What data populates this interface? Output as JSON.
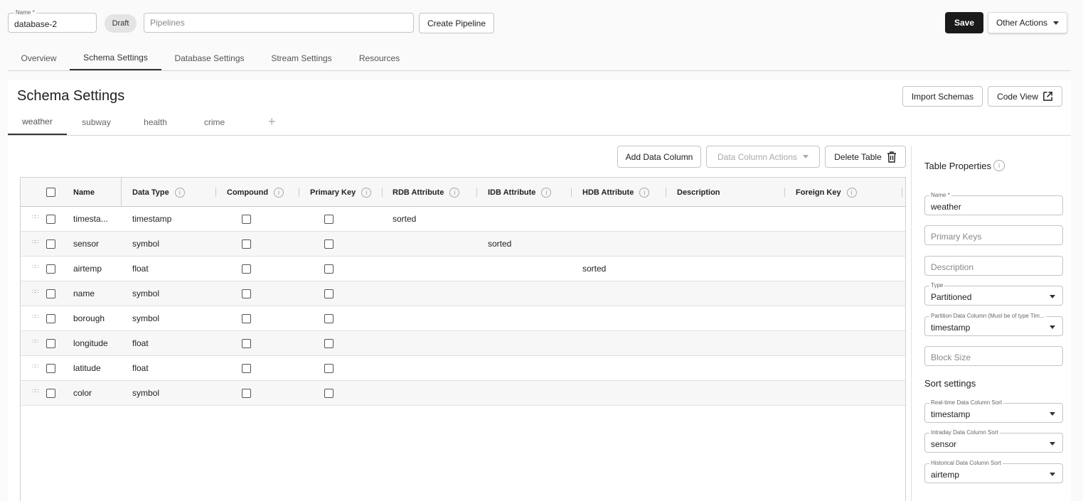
{
  "header": {
    "name_label": "Name *",
    "name_value": "database-2",
    "status_chip": "Draft",
    "pipelines_placeholder": "Pipelines",
    "create_pipeline_label": "Create Pipeline",
    "save_label": "Save",
    "other_actions_label": "Other Actions"
  },
  "main_tabs": [
    "Overview",
    "Schema Settings",
    "Database Settings",
    "Stream Settings",
    "Resources"
  ],
  "active_main_tab": "Schema Settings",
  "schema": {
    "title": "Schema Settings",
    "import_label": "Import Schemas",
    "code_view_label": "Code View",
    "tables": [
      "weather",
      "subway",
      "health",
      "crime"
    ],
    "active_table": "weather",
    "add_column_label": "Add Data Column",
    "column_actions_label": "Data Column Actions",
    "delete_table_label": "Delete Table"
  },
  "grid": {
    "headers": [
      "Name",
      "Data Type",
      "Compound",
      "Primary Key",
      "RDB Attribute",
      "IDB Attribute",
      "HDB Attribute",
      "Description",
      "Foreign Key"
    ],
    "rows": [
      {
        "name": "timesta...",
        "type": "timestamp",
        "rdb": "sorted",
        "idb": "",
        "hdb": ""
      },
      {
        "name": "sensor",
        "type": "symbol",
        "rdb": "",
        "idb": "sorted",
        "hdb": ""
      },
      {
        "name": "airtemp",
        "type": "float",
        "rdb": "",
        "idb": "",
        "hdb": "sorted"
      },
      {
        "name": "name",
        "type": "symbol",
        "rdb": "",
        "idb": "",
        "hdb": ""
      },
      {
        "name": "borough",
        "type": "symbol",
        "rdb": "",
        "idb": "",
        "hdb": ""
      },
      {
        "name": "longitude",
        "type": "float",
        "rdb": "",
        "idb": "",
        "hdb": ""
      },
      {
        "name": "latitude",
        "type": "float",
        "rdb": "",
        "idb": "",
        "hdb": ""
      },
      {
        "name": "color",
        "type": "symbol",
        "rdb": "",
        "idb": "",
        "hdb": ""
      }
    ]
  },
  "properties": {
    "title": "Table Properties",
    "name_label": "Name *",
    "name_value": "weather",
    "primary_keys_placeholder": "Primary Keys",
    "description_placeholder": "Description",
    "type_label": "Type",
    "type_value": "Partitioned",
    "partition_label": "Partition Data Column (Must be of type Tim...",
    "partition_value": "timestamp",
    "block_size_placeholder": "Block Size",
    "sort_title": "Sort settings",
    "rt_sort_label": "Real-time Data Column Sort",
    "rt_sort_value": "timestamp",
    "intraday_sort_label": "Intraday Data Column Sort",
    "intraday_sort_value": "sensor",
    "hist_sort_label": "Historical Data Column Sort",
    "hist_sort_value": "airtemp"
  },
  "icons": {
    "info": "info-icon",
    "external": "external-link-icon",
    "trash": "trash-icon",
    "drag": "drag-handle-icon",
    "add": "plus-icon"
  }
}
